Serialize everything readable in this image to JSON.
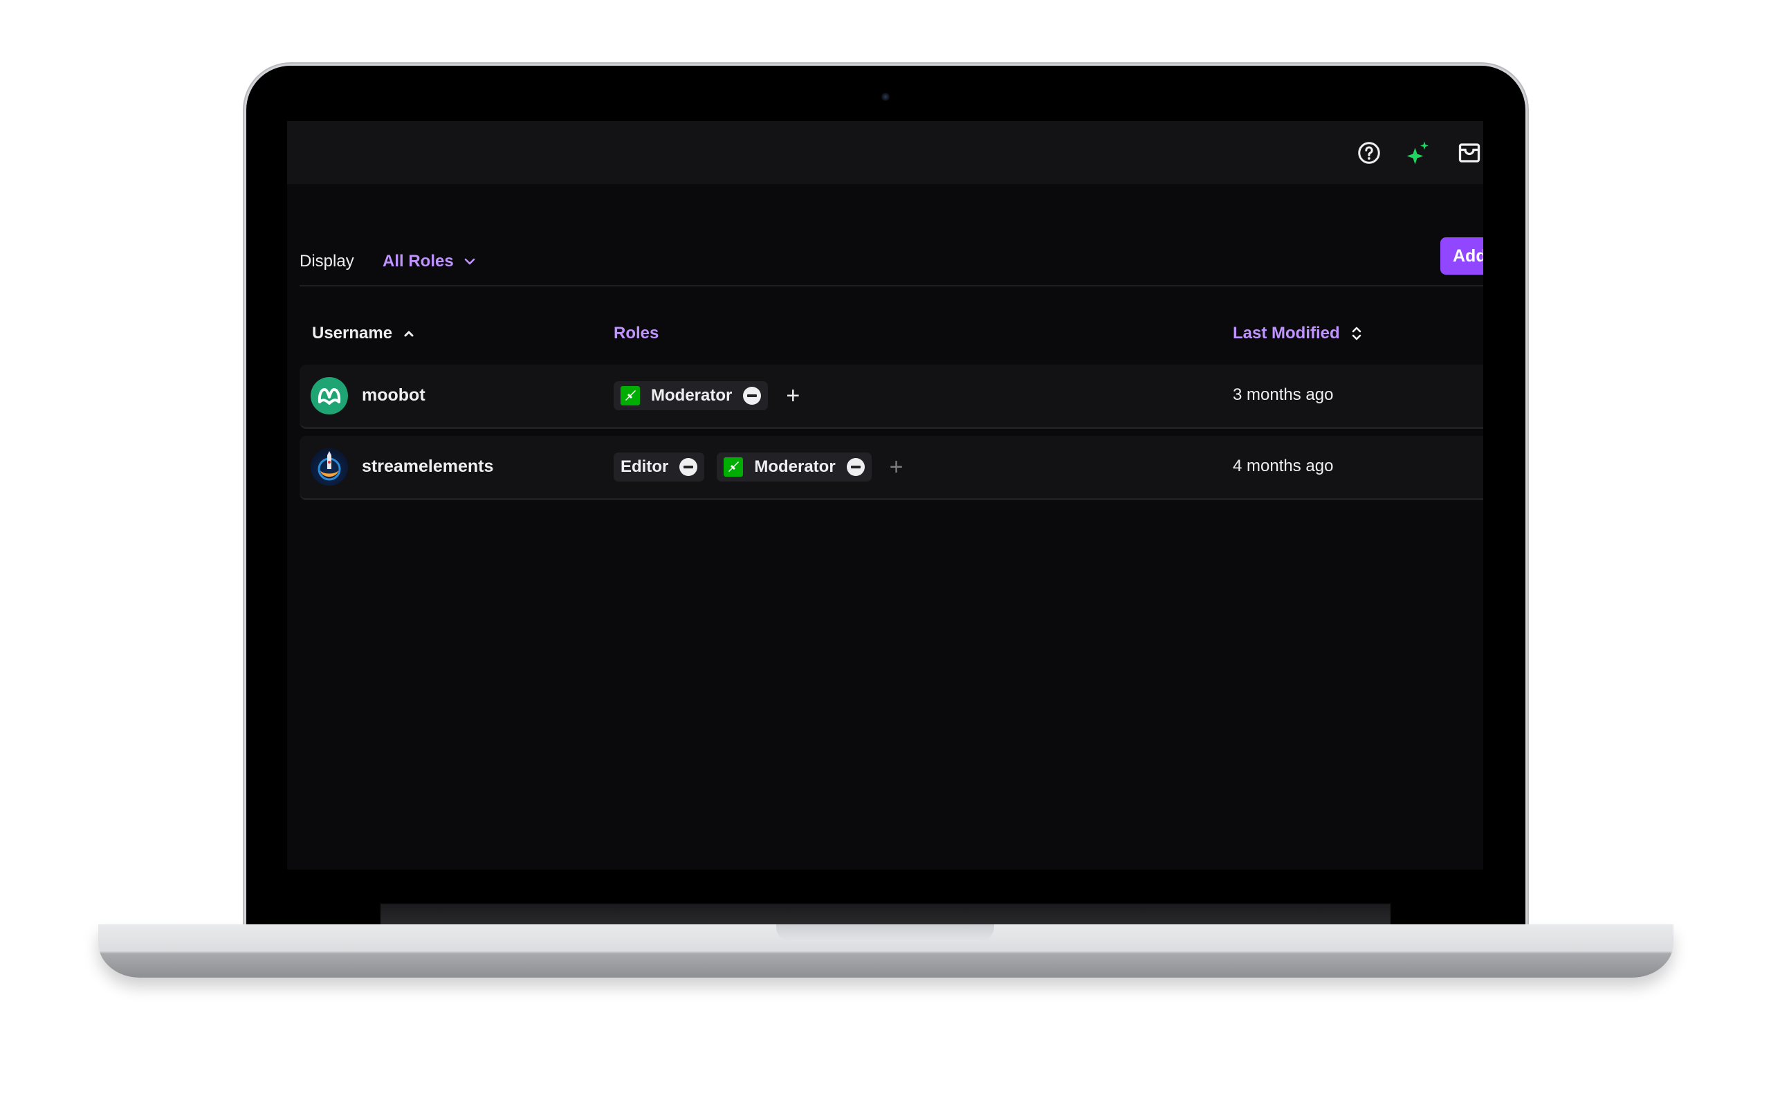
{
  "topbar": {
    "icons": [
      "help-icon",
      "sparkle-icon",
      "inbox-icon"
    ],
    "sparkle_color": "#1ed760"
  },
  "filter": {
    "display_label": "Display",
    "dropdown_value": "All Roles",
    "add_button_label": "Add"
  },
  "table": {
    "headers": {
      "username": "Username",
      "roles": "Roles",
      "last_modified": "Last Modified"
    },
    "sort": {
      "username": "ascending",
      "last_modified": "unsorted"
    },
    "rows": [
      {
        "username": "moobot",
        "avatar": "moobot-logo",
        "roles": [
          {
            "label": "Moderator",
            "badge": "sword-icon"
          }
        ],
        "last_modified": "3 months ago"
      },
      {
        "username": "streamelements",
        "avatar": "streamelements-logo",
        "roles": [
          {
            "label": "Editor",
            "badge": null
          },
          {
            "label": "Moderator",
            "badge": "sword-icon"
          }
        ],
        "last_modified": "4 months ago"
      }
    ]
  },
  "colors": {
    "accent": "#bf94ff",
    "button": "#9147ff",
    "moderator_badge": "#00ad03",
    "background": "#0a0a0c",
    "row": "#121215"
  }
}
